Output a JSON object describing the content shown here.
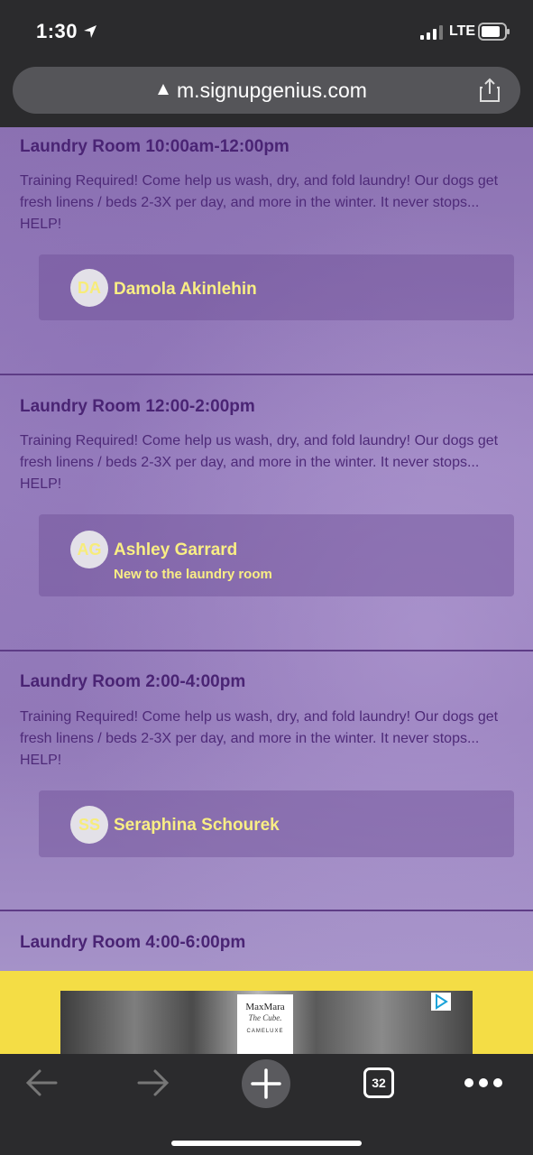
{
  "status_bar": {
    "time": "1:30",
    "network": "LTE"
  },
  "browser": {
    "url": "m.signupgenius.com",
    "tabs_count": "32"
  },
  "slots": [
    {
      "title": "Laundry Room 10:00am-12:00pm",
      "description": "Training Required! Come help us wash, dry, and fold laundry! Our dogs get fresh linens / beds 2-3X per day, and more in the winter. It never stops... HELP!",
      "volunteer": {
        "initials": "DA",
        "name": "Damola Akinlehin",
        "note": ""
      }
    },
    {
      "title": "Laundry Room 12:00-2:00pm",
      "description": "Training Required! Come help us wash, dry, and fold laundry! Our dogs get fresh linens / beds 2-3X per day, and more in the winter. It never stops... HELP!",
      "volunteer": {
        "initials": "AG",
        "name": "Ashley Garrard",
        "note": "New to the laundry room"
      }
    },
    {
      "title": "Laundry Room 2:00-4:00pm",
      "description": "Training Required! Come help us wash, dry, and fold laundry! Our dogs get fresh linens / beds 2-3X per day, and more in the winter. It never stops... HELP!",
      "volunteer": {
        "initials": "SS",
        "name": "Seraphina Schourek",
        "note": ""
      }
    },
    {
      "title": "Laundry Room 4:00-6:00pm"
    }
  ],
  "ad": {
    "brand": "MaxMara",
    "product": "The Cube.",
    "tagline": "CAMELUXE"
  },
  "colors": {
    "background_purple": "#9b83c0",
    "title_purple": "#4a2474",
    "volunteer_yellow": "#f9ee84",
    "ad_yellow": "#f4dd45"
  },
  "icons": [
    "location-arrow-icon",
    "signal-icon",
    "battery-icon",
    "lock-icon",
    "share-icon",
    "back-arrow-icon",
    "forward-arrow-icon",
    "plus-icon",
    "more-icon",
    "ad-choices-icon"
  ]
}
